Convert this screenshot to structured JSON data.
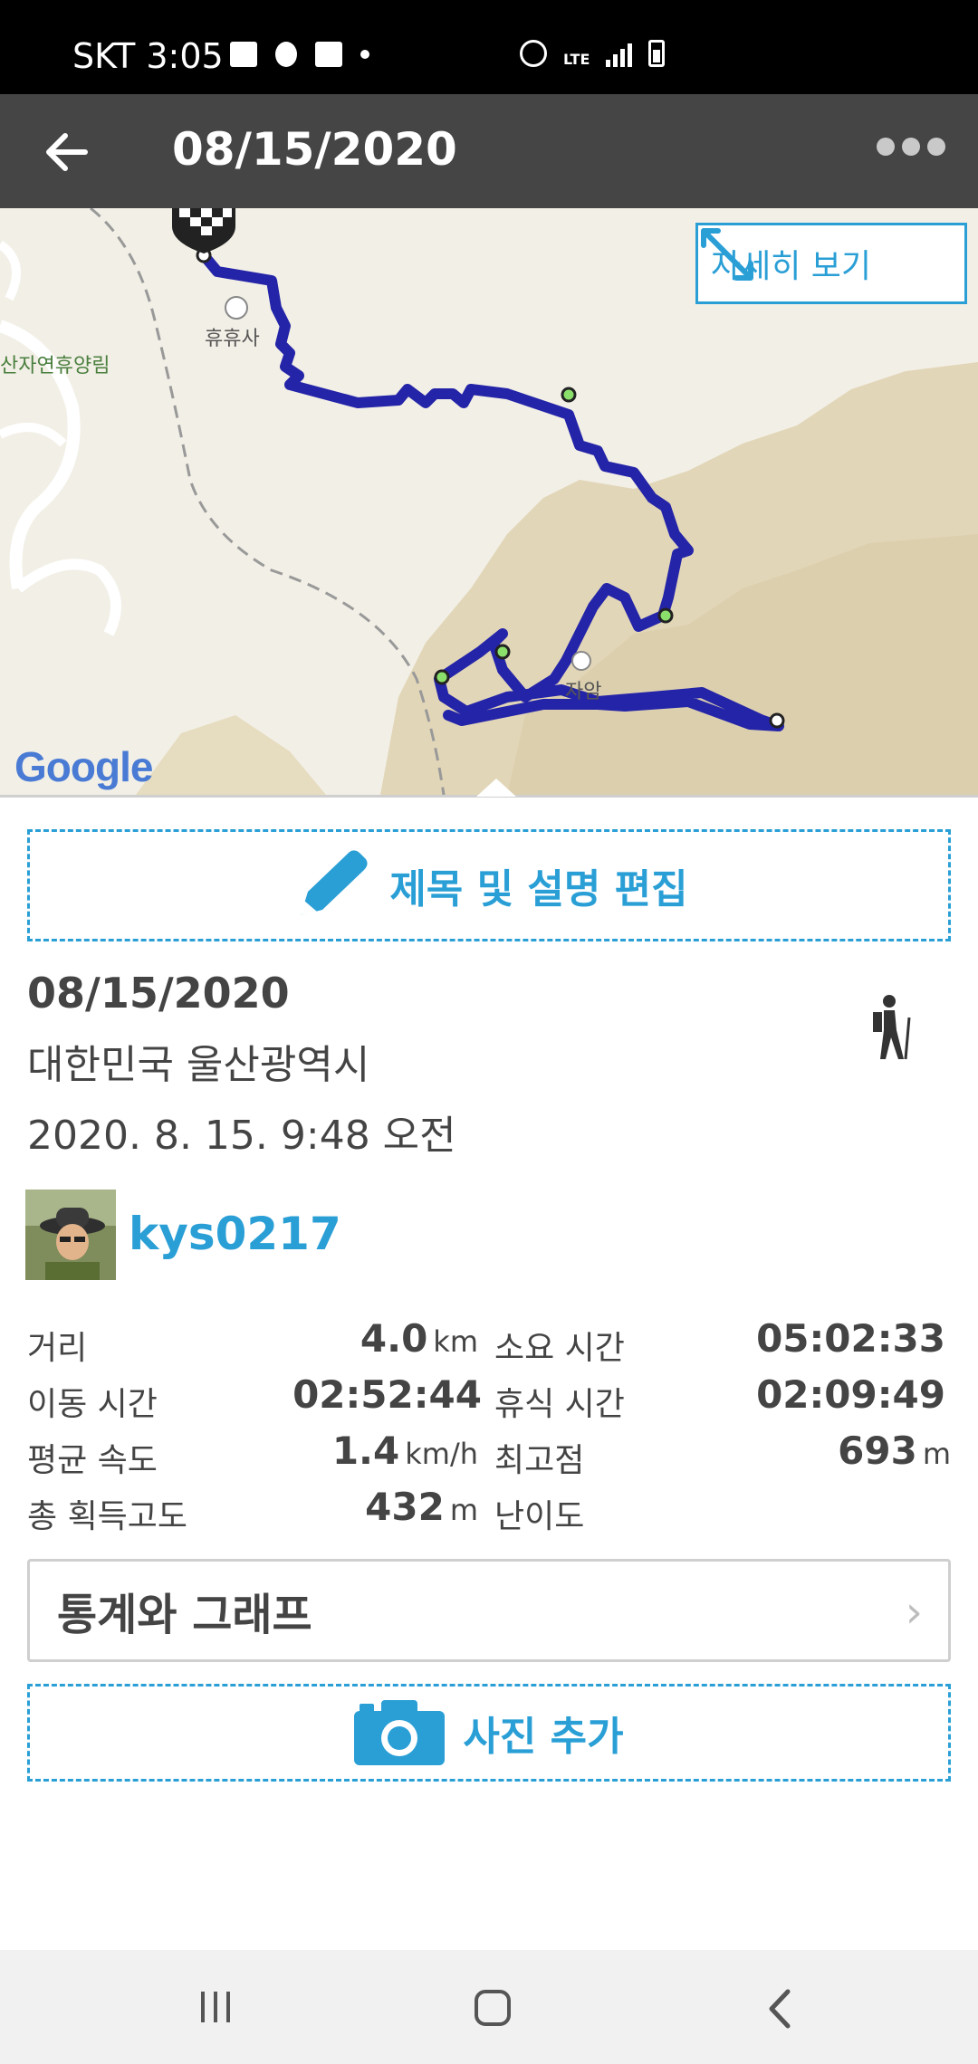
{
  "status_bar": {
    "carrier_time": "SKT 3:05",
    "network": "LTE"
  },
  "app_bar": {
    "title": "08/15/2020"
  },
  "map": {
    "detail_button_label": "자세히 보기",
    "place_labels": [
      "휴휴사",
      "산자연휴양림",
      "자암"
    ],
    "attribution": "Google",
    "route_color": "#2424a8"
  },
  "edit_button": {
    "label": "제목 및 설명 편집"
  },
  "info": {
    "date": "08/15/2020",
    "location": "대한민국 울산광역시",
    "datetime": "2020. 8. 15. 9:48 오전",
    "activity_icon": "hiker-icon"
  },
  "user": {
    "username": "kys0217"
  },
  "stats": {
    "distance_label": "거리",
    "distance_value": "4.0",
    "distance_unit": "km",
    "duration_label": "소요 시간",
    "duration_value": "05:02:33",
    "moving_time_label": "이동 시간",
    "moving_time_value": "02:52:44",
    "rest_time_label": "휴식 시간",
    "rest_time_value": "02:09:49",
    "avg_speed_label": "평균 속도",
    "avg_speed_value": "1.4",
    "avg_speed_unit": "km/h",
    "max_elev_label": "최고점",
    "max_elev_value": "693",
    "max_elev_unit": "m",
    "total_gain_label": "총 획득고도",
    "total_gain_value": "432",
    "total_gain_unit": "m",
    "difficulty_label": "난이도"
  },
  "graph_button": {
    "label": "통계와 그래프",
    "chevron": "›"
  },
  "photo_button": {
    "label": "사진 추가"
  },
  "colors": {
    "accent": "#2a9fd6",
    "app_bar": "#454545",
    "status_bar": "#000000"
  }
}
